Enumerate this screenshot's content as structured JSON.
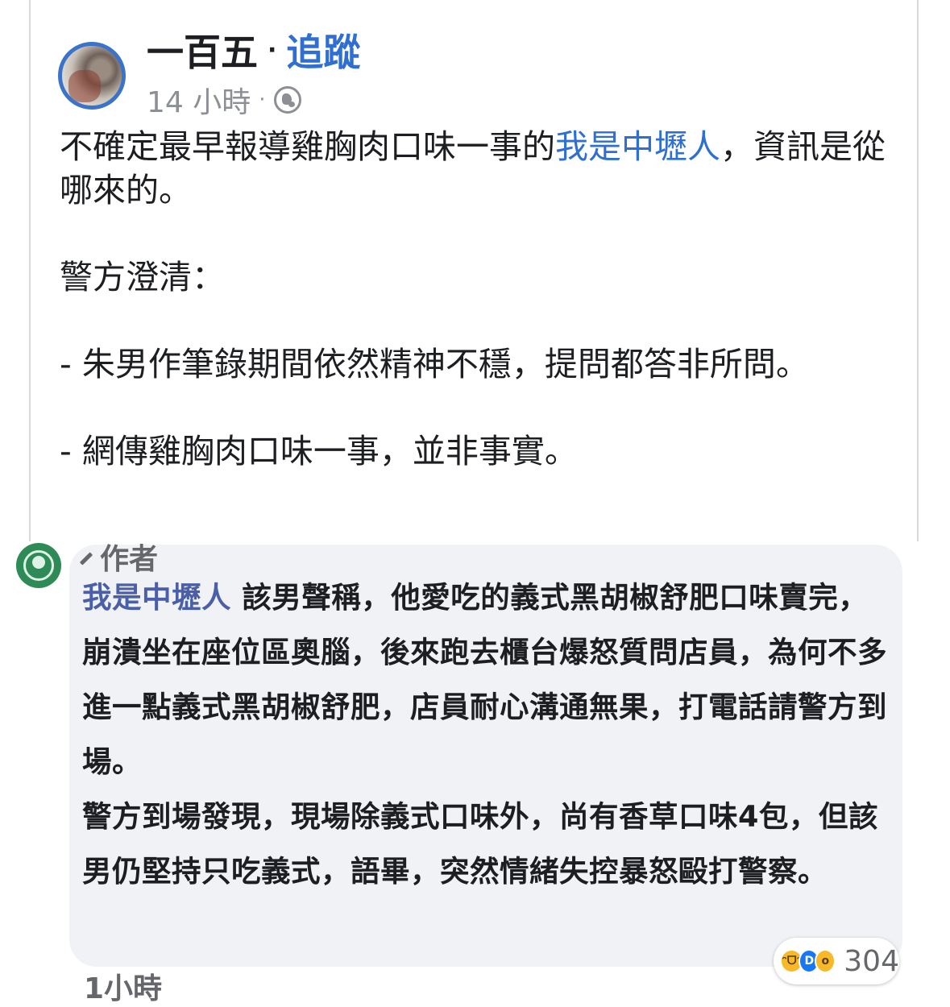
{
  "post": {
    "author_name": "一百五",
    "follow_label": "追蹤",
    "separator": "·",
    "time": "14 小時",
    "audience_icon": "globe-icon",
    "paragraphs": {
      "p1_before": "不確定最早報導雞胸肉口味一事的",
      "p1_link": "我是中壢人",
      "p1_after": "，資訊是從哪來的。",
      "p2": "警方澄清：",
      "p3": "- 朱男作筆錄期間依然精神不穩，提問都答非所問。",
      "p4": "- 網傳雞胸肉口味一事，並非事實。"
    }
  },
  "comment": {
    "badge_icon": "pencil-icon",
    "badge_label": "作者",
    "author_name": "我是中壢人",
    "text_1": " 該男聲稱，他愛吃的義式黑胡椒舒肥口味賣完，崩潰坐在座位區奧腦，後來跑去櫃台爆怒質問店員，為何不多進一點義式黑胡椒舒肥，店員耐心溝通無果，打電話請警方到場。",
    "text_2": "警方到場發現，現場除義式口味外，尚有香草口味4包，但該男仍堅持只吃義式，語畢，突然情緒失控暴怒毆打警察。",
    "reaction_count": "304",
    "reaction_icons": [
      "haha-icon",
      "like-icon",
      "wow-icon"
    ],
    "time": "1小時"
  },
  "colors": {
    "link": "#2f6fd2",
    "comment_name": "#4b5fa8",
    "bubble_bg": "#f0f2f5",
    "muted": "#65676b"
  }
}
